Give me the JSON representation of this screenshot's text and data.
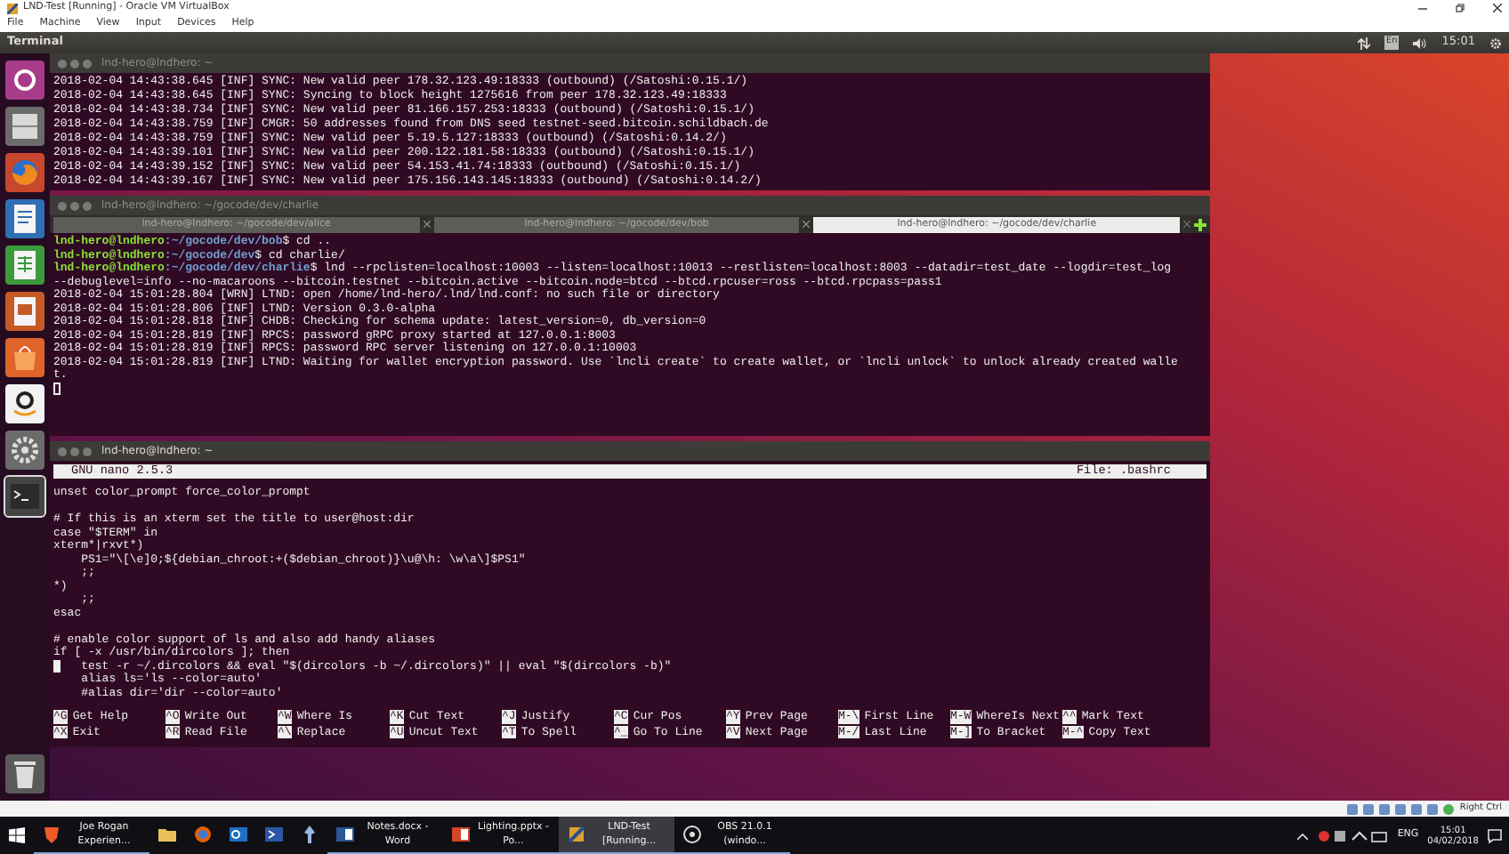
{
  "vm_window": {
    "title": "LND-Test [Running] - Oracle VM VirtualBox",
    "menu": [
      "File",
      "Machine",
      "View",
      "Input",
      "Devices",
      "Help"
    ],
    "status": "Right Ctrl"
  },
  "top_panel": {
    "title": "Terminal",
    "keyboard": "En",
    "clock": "15:01"
  },
  "launcher": [
    {
      "kind": "dash",
      "active": false
    },
    {
      "kind": "files",
      "active": false
    },
    {
      "kind": "browser",
      "active": false
    },
    {
      "kind": "writer",
      "active": false
    },
    {
      "kind": "calc",
      "active": false
    },
    {
      "kind": "impress",
      "active": false
    },
    {
      "kind": "store",
      "active": false
    },
    {
      "kind": "amazon",
      "active": false
    },
    {
      "kind": "settings",
      "active": false
    },
    {
      "kind": "terminal",
      "active": true
    },
    {
      "kind": "trash",
      "active": false
    }
  ],
  "terminals": [
    {
      "title": "lnd-hero@lndhero: ~",
      "focused": false,
      "lines": [
        {
          "kind": "log",
          "text": "2018-02-04 14:43:38.645 [INF] SYNC: New valid peer 178.32.123.49:18333 (outbound) (/Satoshi:0.15.1/)"
        },
        {
          "kind": "log",
          "text": "2018-02-04 14:43:38.645 [INF] SYNC: Syncing to block height 1275616 from peer 178.32.123.49:18333"
        },
        {
          "kind": "log",
          "text": "2018-02-04 14:43:38.734 [INF] SYNC: New valid peer 81.166.157.253:18333 (outbound) (/Satoshi:0.15.1/)"
        },
        {
          "kind": "log",
          "text": "2018-02-04 14:43:38.759 [INF] CMGR: 50 addresses found from DNS seed testnet-seed.bitcoin.schildbach.de"
        },
        {
          "kind": "log",
          "text": "2018-02-04 14:43:38.759 [INF] SYNC: New valid peer 5.19.5.127:18333 (outbound) (/Satoshi:0.14.2/)"
        },
        {
          "kind": "log",
          "text": "2018-02-04 14:43:39.101 [INF] SYNC: New valid peer 200.122.181.58:18333 (outbound) (/Satoshi:0.15.1/)"
        },
        {
          "kind": "log",
          "text": "2018-02-04 14:43:39.152 [INF] SYNC: New valid peer 54.153.41.74:18333 (outbound) (/Satoshi:0.15.1/)"
        },
        {
          "kind": "log",
          "text": "2018-02-04 14:43:39.167 [INF] SYNC: New valid peer 175.156.143.145:18333 (outbound) (/Satoshi:0.14.2/)"
        }
      ]
    },
    {
      "title": "lnd-hero@lndhero: ~/gocode/dev/charlie",
      "focused": false,
      "tabs": [
        {
          "label": "lnd-hero@lndhero: ~/gocode/dev/alice",
          "selected": false
        },
        {
          "label": "lnd-hero@lndhero: ~/gocode/dev/bob",
          "selected": false
        },
        {
          "label": "lnd-hero@lndhero: ~/gocode/dev/charlie",
          "selected": true
        }
      ],
      "lines": [
        {
          "kind": "prompt",
          "user": "lnd-hero@lndhero",
          "path": ":~/gocode/dev/bob",
          "command": "$ cd .."
        },
        {
          "kind": "prompt",
          "user": "lnd-hero@lndhero",
          "path": ":~/gocode/dev",
          "command": "$ cd charlie/"
        },
        {
          "kind": "prompt",
          "user": "lnd-hero@lndhero",
          "path": ":~/gocode/dev/charlie",
          "command": "$ lnd --rpclisten=localhost:10003 --listen=localhost:10013 --restlisten=localhost:8003 --datadir=test_date --logdir=test_log"
        },
        {
          "kind": "log",
          "text": "--debuglevel=info --no-macaroons --bitcoin.testnet --bitcoin.active --bitcoin.node=btcd --btcd.rpcuser=ross --btcd.rpcpass=pass1"
        },
        {
          "kind": "log",
          "text": "2018-02-04 15:01:28.804 [WRN] LTND: open /home/lnd-hero/.lnd/lnd.conf: no such file or directory"
        },
        {
          "kind": "log",
          "text": "2018-02-04 15:01:28.806 [INF] LTND: Version 0.3.0-alpha"
        },
        {
          "kind": "log",
          "text": "2018-02-04 15:01:28.818 [INF] CHDB: Checking for schema update: latest_version=0, db_version=0"
        },
        {
          "kind": "log",
          "text": "2018-02-04 15:01:28.819 [INF] RPCS: password gRPC proxy started at 127.0.0.1:8003"
        },
        {
          "kind": "log",
          "text": "2018-02-04 15:01:28.819 [INF] RPCS: password RPC server listening on 127.0.0.1:10003"
        },
        {
          "kind": "log",
          "text": "2018-02-04 15:01:28.819 [INF] LTND: Waiting for wallet encryption password. Use `lncli create` to create wallet, or `lncli unlock` to unlock already created walle"
        },
        {
          "kind": "log",
          "text": "t."
        },
        {
          "kind": "cursor"
        }
      ]
    }
  ],
  "nano": {
    "title": "lnd-hero@lndhero: ~",
    "version": "GNU nano 2.5.3",
    "file": "File: .bashrc",
    "lines": [
      {
        "kind": "text",
        "text": "unset color_prompt force_color_prompt",
        "cursor": false
      },
      {
        "kind": "blank"
      },
      {
        "kind": "text",
        "text": "# If this is an xterm set the title to user@host:dir",
        "cursor": false
      },
      {
        "kind": "text",
        "text": "case \"$TERM\" in",
        "cursor": false
      },
      {
        "kind": "text",
        "text": "xterm*|rxvt*)",
        "cursor": false
      },
      {
        "kind": "text",
        "text": "    PS1=\"\\[\\e]0;${debian_chroot:+($debian_chroot)}\\u@\\h: \\w\\a\\]$PS1\"",
        "cursor": false
      },
      {
        "kind": "text",
        "text": "    ;;",
        "cursor": false
      },
      {
        "kind": "text",
        "text": "*)",
        "cursor": false
      },
      {
        "kind": "text",
        "text": "    ;;",
        "cursor": false
      },
      {
        "kind": "text",
        "text": "esac",
        "cursor": false
      },
      {
        "kind": "blank"
      },
      {
        "kind": "text",
        "text": "# enable color support of ls and also add handy aliases",
        "cursor": false
      },
      {
        "kind": "text",
        "text": "if [ -x /usr/bin/dircolors ]; then",
        "cursor": false
      },
      {
        "kind": "text",
        "text": "    test -r ~/.dircolors && eval \"$(dircolors -b ~/.dircolors)\" || eval \"$(dircolors -b)\"",
        "cursor": true
      },
      {
        "kind": "text",
        "text": "    alias ls='ls --color=auto'",
        "cursor": false
      },
      {
        "kind": "text",
        "text": "    #alias dir='dir --color=auto'",
        "cursor": false
      }
    ],
    "shortcuts": [
      [
        {
          "key": "^G",
          "label": "Get Help"
        },
        {
          "key": "^O",
          "label": "Write Out"
        },
        {
          "key": "^W",
          "label": "Where Is"
        },
        {
          "key": "^K",
          "label": "Cut Text"
        },
        {
          "key": "^J",
          "label": "Justify"
        },
        {
          "key": "^C",
          "label": "Cur Pos"
        },
        {
          "key": "^Y",
          "label": "Prev Page"
        },
        {
          "key": "M-\\",
          "label": "First Line"
        },
        {
          "key": "M-W",
          "label": "WhereIs Next"
        },
        {
          "key": "^^",
          "label": "Mark Text"
        }
      ],
      [
        {
          "key": "^X",
          "label": "Exit"
        },
        {
          "key": "^R",
          "label": "Read File"
        },
        {
          "key": "^\\",
          "label": "Replace"
        },
        {
          "key": "^U",
          "label": "Uncut Text"
        },
        {
          "key": "^T",
          "label": "To Spell"
        },
        {
          "key": "^_",
          "label": "Go To Line"
        },
        {
          "key": "^V",
          "label": "Next Page"
        },
        {
          "key": "M-/",
          "label": "Last Line"
        },
        {
          "key": "M-]",
          "label": "To Bracket"
        },
        {
          "key": "M-^",
          "label": "Copy Text"
        }
      ]
    ]
  },
  "taskbar": {
    "items": [
      {
        "kind": "start",
        "selected": false
      },
      {
        "kind": "window",
        "label": "Joe Rogan Experien...",
        "selected": false
      },
      {
        "kind": "pinned",
        "selected": false
      },
      {
        "kind": "pinned",
        "selected": false
      },
      {
        "kind": "pinned",
        "selected": false
      },
      {
        "kind": "pinned",
        "selected": false
      },
      {
        "kind": "pinned",
        "selected": false
      },
      {
        "kind": "window",
        "label": "Notes.docx - Word",
        "selected": false
      },
      {
        "kind": "window",
        "label": "Lighting.pptx - Po...",
        "selected": false
      },
      {
        "kind": "window",
        "label": "LND-Test [Running...",
        "selected": true
      },
      {
        "kind": "window",
        "label": "OBS 21.0.1 (windo...",
        "selected": false
      }
    ],
    "tray": {
      "language": "ENG",
      "time": "15:01",
      "date": "04/02/2018"
    }
  }
}
